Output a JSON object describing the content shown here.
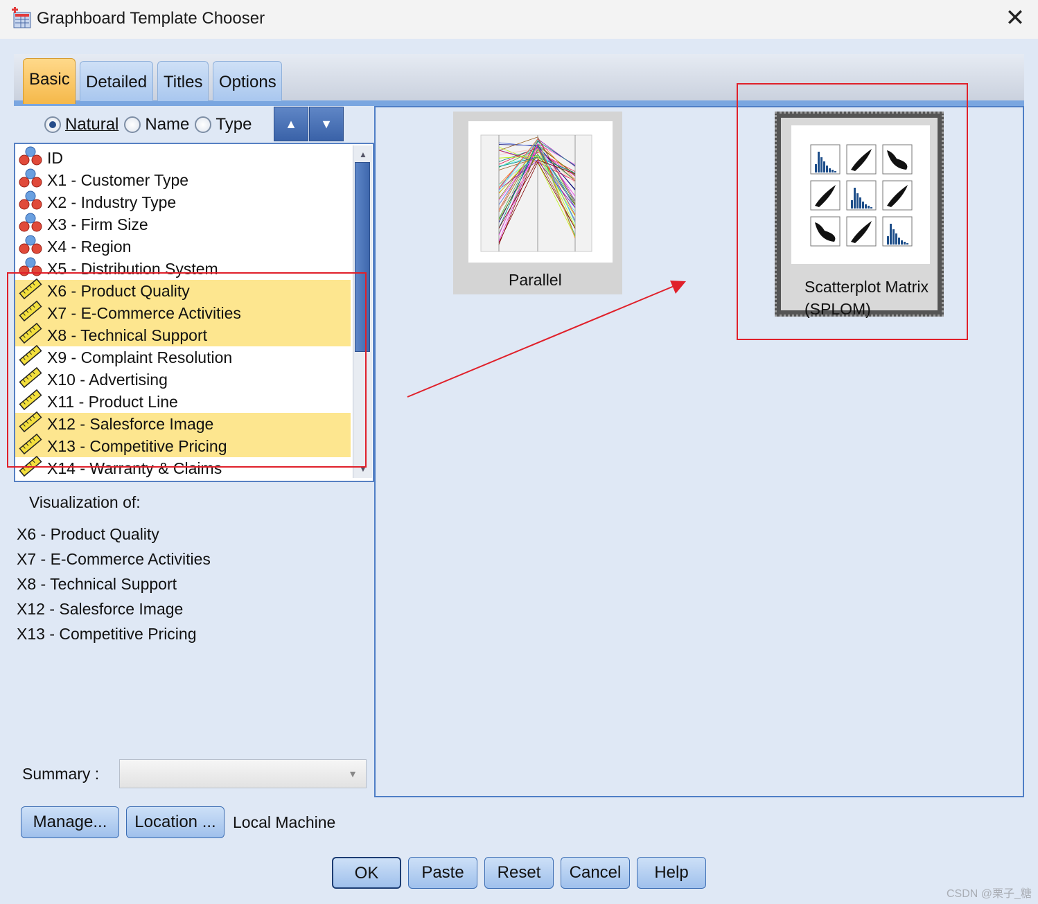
{
  "window": {
    "title": "Graphboard Template Chooser",
    "close_glyph": "✕"
  },
  "tabs": [
    {
      "label": "Basic",
      "active": true
    },
    {
      "label": "Detailed",
      "active": false
    },
    {
      "label": "Titles",
      "active": false
    },
    {
      "label": "Options",
      "active": false
    }
  ],
  "sort": {
    "options": [
      {
        "label": "Natural",
        "selected": true
      },
      {
        "label": "Name",
        "selected": false
      },
      {
        "label": "Type",
        "selected": false
      }
    ],
    "ascending_glyph": "▲",
    "descending_glyph": "▼"
  },
  "variables": [
    {
      "label": "ID",
      "kind": "nominal",
      "selected": false
    },
    {
      "label": "X1 - Customer Type",
      "kind": "nominal",
      "selected": false
    },
    {
      "label": "X2 - Industry Type",
      "kind": "nominal",
      "selected": false
    },
    {
      "label": "X3 - Firm Size",
      "kind": "nominal",
      "selected": false
    },
    {
      "label": "X4 - Region",
      "kind": "nominal",
      "selected": false
    },
    {
      "label": "X5 - Distribution System",
      "kind": "nominal",
      "selected": false
    },
    {
      "label": "X6 - Product Quality",
      "kind": "scale",
      "selected": true
    },
    {
      "label": "X7 - E-Commerce Activities",
      "kind": "scale",
      "selected": true
    },
    {
      "label": "X8 - Technical Support",
      "kind": "scale",
      "selected": true
    },
    {
      "label": "X9 - Complaint Resolution",
      "kind": "scale",
      "selected": false
    },
    {
      "label": "X10 - Advertising",
      "kind": "scale",
      "selected": false
    },
    {
      "label": "X11 - Product Line",
      "kind": "scale",
      "selected": false
    },
    {
      "label": "X12 - Salesforce Image",
      "kind": "scale",
      "selected": true
    },
    {
      "label": "X13 - Competitive Pricing",
      "kind": "scale",
      "selected": true
    },
    {
      "label": "X14 - Warranty & Claims",
      "kind": "scale",
      "selected": false
    }
  ],
  "visualization": {
    "heading": "Visualization of:",
    "items": [
      "X6 - Product Quality",
      "X7 - E-Commerce Activities",
      "X8 - Technical Support",
      "X12 - Salesforce Image",
      "X13 - Competitive Pricing"
    ]
  },
  "summary": {
    "label": "Summary :",
    "value": ""
  },
  "manage_label": "Manage...",
  "location_label": "Location ...",
  "location_value": "Local Machine",
  "templates": [
    {
      "label": "Parallel",
      "selected": false
    },
    {
      "label": "Scatterplot Matrix (SPLOM)",
      "selected": true
    }
  ],
  "footer_buttons": [
    "OK",
    "Paste",
    "Reset",
    "Cancel",
    "Help"
  ],
  "watermark": "CSDN @栗子_糖",
  "colors": {
    "selection": "#fde68f",
    "annotation_red": "#e0202a",
    "accent": "#4f7ec6"
  },
  "icons": {
    "nominal": "nominal-measure-icon",
    "scale": "scale-ruler-icon"
  }
}
